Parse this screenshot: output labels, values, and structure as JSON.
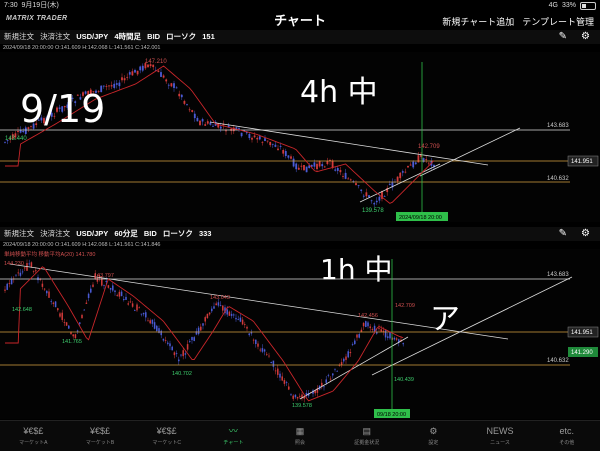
{
  "status": {
    "time": "7:30",
    "date": "9月19日(木)",
    "signal": "4G",
    "battery": "33%"
  },
  "header": {
    "logo": "MATRIX TRADER",
    "title": "チャート",
    "add_chart": "新規チャート追加",
    "template": "テンプレート管理"
  },
  "panel1": {
    "new_order": "新規注文",
    "settle_order": "決済注文",
    "pair": "USD/JPY",
    "period": "4時間足",
    "side": "BID",
    "candle": "ローソク",
    "count": "151",
    "info": "2024/09/18 20:00:00   O:141.609  H:142.068  L:141.561  C:142.001",
    "prices": {
      "p1": "143.683",
      "p2": "141.951",
      "p3": "140.632",
      "high": "147.210",
      "left": "143.440",
      "low": "139.578",
      "local": "142.709"
    },
    "date_label": "2024/09/18 20:00",
    "annotations": [
      "9/19",
      "4h 中"
    ]
  },
  "panel2": {
    "new_order": "新規注文",
    "settle_order": "決済注文",
    "pair": "USD/JPY",
    "period": "60分足",
    "side": "BID",
    "candle": "ローソク",
    "count": "333",
    "info": "2024/09/18 20:00:00   O:141.609  H:142.068  L:141.561  C:141.846",
    "legend": "単純移動平均  移動平均A(20) 141.780",
    "prices": {
      "p1": "143.683",
      "p2": "141.951",
      "p3": "141.290",
      "p4": "140.632",
      "top": "144.230",
      "h1": "143.797",
      "h2": "143.043",
      "h3": "142.456",
      "h4": "142.709",
      "l1": "142.648",
      "l2": "141.765",
      "l3": "140.702",
      "l4": "140.439",
      "low": "139.578"
    },
    "date_label": "09/18 20:00",
    "annotations": [
      "1h 中",
      "ア"
    ]
  },
  "tabs": [
    {
      "icon": "¥€$£",
      "label": "マーケットA"
    },
    {
      "icon": "¥€$£",
      "label": "マーケットB"
    },
    {
      "icon": "¥€$£",
      "label": "マーケットC"
    },
    {
      "icon": "〰",
      "label": "チャート"
    },
    {
      "icon": "▦",
      "label": "照会"
    },
    {
      "icon": "▤",
      "label": "証拠金状況"
    },
    {
      "icon": "⚙",
      "label": "設定"
    },
    {
      "icon": "NEWS",
      "label": "ニュース"
    },
    {
      "icon": "etc.",
      "label": "その他"
    }
  ],
  "colors": {
    "up": "#d23a3a",
    "down": "#4a5bd6",
    "ma": "#c8262a",
    "accent": "#3ecf6e"
  }
}
